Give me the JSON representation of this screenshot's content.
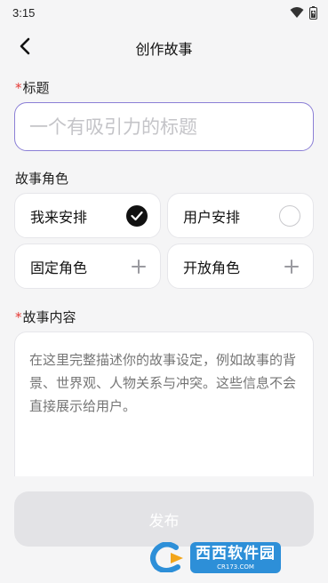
{
  "status_bar": {
    "time": "3:15"
  },
  "header": {
    "title": "创作故事"
  },
  "title_field": {
    "required_mark": "*",
    "label": "标题",
    "placeholder": "一个有吸引力的标题",
    "value": ""
  },
  "role_section": {
    "label": "故事角色",
    "options": [
      {
        "label": "我来安排",
        "state": "selected"
      },
      {
        "label": "用户安排",
        "state": "unselected"
      },
      {
        "label": "固定角色",
        "state": "add"
      },
      {
        "label": "开放角色",
        "state": "add"
      }
    ]
  },
  "content_field": {
    "required_mark": "*",
    "label": "故事内容",
    "placeholder": "在这里完整描述你的故事设定，例如故事的背景、世界观、人物关系与冲突。这些信息不会直接展示给用户。",
    "value": ""
  },
  "publish_button": {
    "label": "发布",
    "enabled": false
  },
  "watermark": {
    "brand": "西西软件园",
    "url": "CR173.COM"
  },
  "colors": {
    "accent_border": "#8b7fd6",
    "required": "#e53935",
    "disabled_button": "#e3e3e6"
  }
}
